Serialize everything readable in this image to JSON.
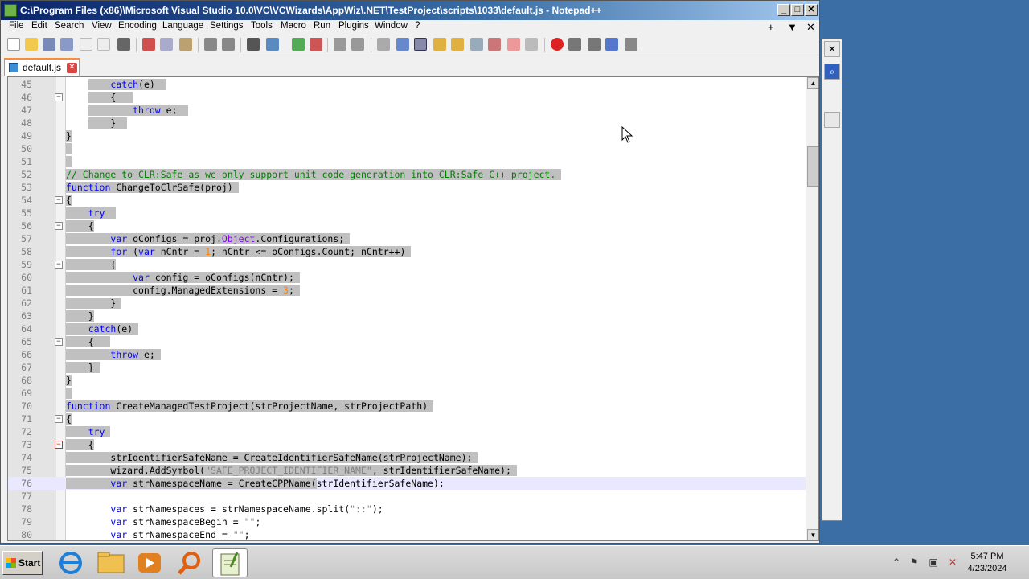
{
  "window": {
    "title": "C:\\Program Files (x86)\\Microsoft Visual Studio 10.0\\VC\\VCWizards\\AppWiz\\.NET\\TestProject\\scripts\\1033\\default.js - Notepad++",
    "minimize": "_",
    "maximize": "□",
    "close": "✕"
  },
  "menu": [
    "File",
    "Edit",
    "Search",
    "View",
    "Encoding",
    "Language",
    "Settings",
    "Tools",
    "Macro",
    "Run",
    "Plugins",
    "Window",
    "?"
  ],
  "menu_right": {
    "plus": "+",
    "down": "▼",
    "close": "✕"
  },
  "tab": {
    "name": "default.js",
    "close": "✕"
  },
  "editor": {
    "lines": [
      {
        "n": "45",
        "fold": "",
        "html": "    <span class=\"sel\">    <span class=\"kw\">catch</span>(e)  </span>"
      },
      {
        "n": "46",
        "fold": "−",
        "html": "    <span class=\"sel\">    {   </span>"
      },
      {
        "n": "47",
        "fold": "",
        "html": "    <span class=\"sel\">        <span class=\"kw\">throw</span> e;  </span>"
      },
      {
        "n": "48",
        "fold": "",
        "html": "    <span class=\"sel\">    }  </span>"
      },
      {
        "n": "49",
        "fold": "",
        "html": "<span class=\"sel\">}</span>"
      },
      {
        "n": "50",
        "fold": "",
        "html": "<span class=\"sel\"> </span>"
      },
      {
        "n": "51",
        "fold": "",
        "html": "<span class=\"sel\"> </span>"
      },
      {
        "n": "52",
        "fold": "",
        "html": "<span class=\"sel\"><span class=\"cm\">// Change to CLR:Safe as we only support unit code generation into CLR:Safe C++ project.</span> </span>"
      },
      {
        "n": "53",
        "fold": "",
        "html": "<span class=\"sel\"><span class=\"kw\">function</span> ChangeToClrSafe(proj) </span>"
      },
      {
        "n": "54",
        "fold": "−",
        "html": "<span class=\"sel\">{</span>"
      },
      {
        "n": "55",
        "fold": "",
        "html": "<span class=\"sel\">    <span class=\"kw\">try</span>  </span>"
      },
      {
        "n": "56",
        "fold": "−",
        "html": "<span class=\"sel\">    {</span>"
      },
      {
        "n": "57",
        "fold": "",
        "html": "<span class=\"sel\">        <span class=\"kw\">var</span> oConfigs = proj.<span class=\"obj\">Object</span>.Configurations; </span>"
      },
      {
        "n": "58",
        "fold": "",
        "html": "<span class=\"sel\">        <span class=\"kw\">for</span> (<span class=\"kw\">var</span> nCntr = <span class=\"num\">1</span>; nCntr &lt;= oConfigs.Count; nCntr++) </span>"
      },
      {
        "n": "59",
        "fold": "−",
        "html": "<span class=\"sel\">        {</span>"
      },
      {
        "n": "60",
        "fold": "",
        "html": "<span class=\"sel\">            <span class=\"kw\">var</span> config = oConfigs(nCntr); </span>"
      },
      {
        "n": "61",
        "fold": "",
        "html": "<span class=\"sel\">            config.ManagedExtensions = <span class=\"num\">3</span>; </span>"
      },
      {
        "n": "62",
        "fold": "",
        "html": "<span class=\"sel\">        } </span>"
      },
      {
        "n": "63",
        "fold": "",
        "html": "<span class=\"sel\">    }</span>"
      },
      {
        "n": "64",
        "fold": "",
        "html": "<span class=\"sel\">    <span class=\"kw\">catch</span>(e) </span>"
      },
      {
        "n": "65",
        "fold": "−",
        "html": "<span class=\"sel\">    {   </span>"
      },
      {
        "n": "66",
        "fold": "",
        "html": "<span class=\"sel\">        <span class=\"kw\">throw</span> e; </span>"
      },
      {
        "n": "67",
        "fold": "",
        "html": "<span class=\"sel\">    } </span>"
      },
      {
        "n": "68",
        "fold": "",
        "html": "<span class=\"sel\">}</span>"
      },
      {
        "n": "69",
        "fold": "",
        "html": "<span class=\"sel\"> </span>"
      },
      {
        "n": "70",
        "fold": "",
        "html": "<span class=\"sel\"><span class=\"kw\">function</span> CreateManagedTestProject(strProjectName, strProjectPath) </span>"
      },
      {
        "n": "71",
        "fold": "−",
        "html": "<span class=\"sel\">{</span>"
      },
      {
        "n": "72",
        "fold": "",
        "html": "<span class=\"sel\">    <span class=\"kw\">try</span> </span>"
      },
      {
        "n": "73",
        "fold": "−r",
        "html": "<span class=\"sel\">    {</span>"
      },
      {
        "n": "74",
        "fold": "",
        "html": "<span class=\"sel\">        strIdentifierSafeName = CreateIdentifierSafeName(strProjectName); </span>"
      },
      {
        "n": "75",
        "fold": "",
        "html": "<span class=\"sel\">        wizard.AddSymbol(<span class=\"str\">\"SAFE_PROJECT_IDENTIFIER_NAME\"</span>, strIdentifierSafeName); </span>"
      },
      {
        "n": "76",
        "fold": "",
        "html": "<span class=\"sel\">        <span class=\"kw\">var</span> strNamespaceName = CreateCPPName(</span>strIdentifierSafeName);"
      },
      {
        "n": "77",
        "fold": "",
        "html": ""
      },
      {
        "n": "78",
        "fold": "",
        "html": "        <span class=\"kw\">var</span> strNamespaces = strNamespaceName.split(<span class=\"str\">\"::\"</span>);"
      },
      {
        "n": "79",
        "fold": "",
        "html": "        <span class=\"kw\">var</span> strNamespaceBegin = <span class=\"str\">\"\"</span>;"
      },
      {
        "n": "80",
        "fold": "",
        "html": "        <span class=\"kw\">var</span> strNamespaceEnd = <span class=\"str\">\"\"</span>;"
      }
    ]
  },
  "taskbar": {
    "start": "Start",
    "items": [
      "internet-explorer",
      "file-explorer",
      "media-player",
      "search-tool",
      "notepad-plus-plus"
    ],
    "clock_time": "5:47 PM",
    "clock_date": "4/23/2024"
  },
  "colors": {
    "title_bar": "#0a246a",
    "selection": "#c0c0c0",
    "keyword": "#0000ff",
    "comment": "#008000",
    "number": "#ff8000",
    "desktop": "#3a6ea5"
  }
}
